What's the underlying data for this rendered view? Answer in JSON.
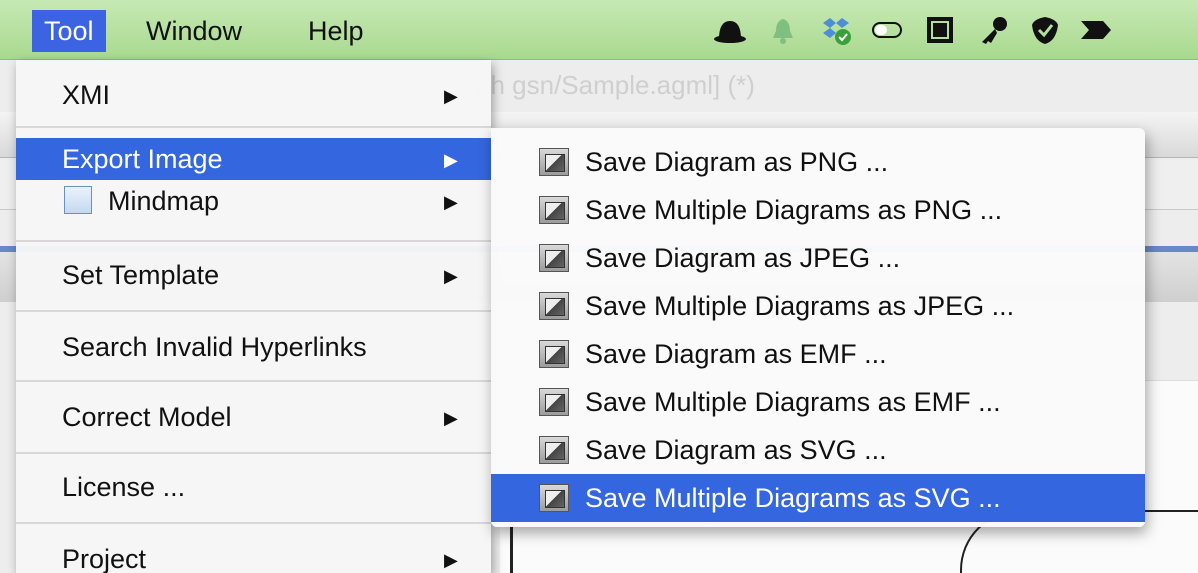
{
  "menubar": {
    "items": [
      "Tool",
      "Window",
      "Help"
    ],
    "active": "Tool",
    "tray_icons": [
      "bowler-hat-icon",
      "bell-icon",
      "dropbox-sync-icon",
      "toggle-icon",
      "memory-chip-icon",
      "key-icon",
      "shield-check-icon",
      "arrows-icon"
    ]
  },
  "background": {
    "title": "ah gsn/Sample.agml] (*)"
  },
  "tool_menu": {
    "items": [
      {
        "label": "XMI",
        "submenu": true
      },
      {
        "label": "Export Image",
        "submenu": true,
        "active": true
      },
      {
        "label": "Mindmap",
        "submenu": true,
        "icon": "mindmap-icon"
      },
      {
        "label": "Set Template",
        "submenu": true
      },
      {
        "label": "Search Invalid Hyperlinks",
        "submenu": false
      },
      {
        "label": "Correct Model",
        "submenu": true
      },
      {
        "label": "License ...",
        "submenu": false
      },
      {
        "label": "Project",
        "submenu": true
      }
    ]
  },
  "export_submenu": {
    "items": [
      "Save Diagram as PNG ...",
      "Save Multiple Diagrams as PNG ...",
      "Save Diagram as JPEG ...",
      "Save Multiple Diagrams as JPEG ...",
      "Save Diagram as EMF ...",
      "Save Multiple Diagrams as EMF ...",
      "Save Diagram as SVG ...",
      "Save Multiple Diagrams as SVG ..."
    ],
    "active_index": 7
  },
  "colors": {
    "highlight": "#3466df",
    "menubar": "#b5df9e"
  }
}
